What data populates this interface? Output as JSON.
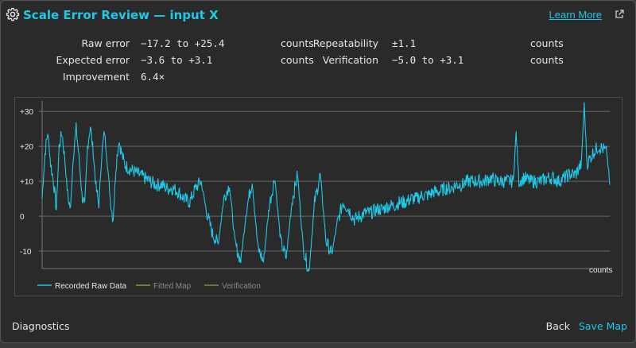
{
  "dialog": {
    "title": "Scale Error Review — input X",
    "learn_more": "Learn More",
    "icons": {
      "settings": "gear-icon",
      "external": "external-link-icon"
    }
  },
  "stats": {
    "raw_error": {
      "label": "Raw error",
      "value": "−17.2 to +25.4",
      "unit": "counts"
    },
    "expected_error": {
      "label": "Expected error",
      "value": "−3.6 to +3.1",
      "unit": "counts"
    },
    "improvement": {
      "label": "Improvement",
      "value": "6.4×"
    },
    "repeatability": {
      "label": "Repeatability",
      "value": "±1.1",
      "unit": "counts"
    },
    "verification": {
      "label": "Verification",
      "value": "−5.0 to +3.1",
      "unit": "counts"
    }
  },
  "chart_data": {
    "type": "line",
    "y_ticks": [
      "+30",
      "+20",
      "+10",
      "0",
      "-10"
    ],
    "ylim": [
      -15,
      33
    ],
    "unit_label": "counts",
    "grid": true,
    "legend_position": "bottom-left",
    "series": [
      {
        "name": "Recorded Raw Data",
        "color": "#1ec8e6",
        "points": [
          [
            0,
            5
          ],
          [
            0.5,
            18
          ],
          [
            1,
            24
          ],
          [
            1.5,
            15
          ],
          [
            2,
            10
          ],
          [
            2.5,
            2
          ],
          [
            3,
            20
          ],
          [
            3.5,
            24
          ],
          [
            4,
            16
          ],
          [
            4.5,
            6
          ],
          [
            5,
            2
          ],
          [
            5.5,
            18
          ],
          [
            6,
            25
          ],
          [
            6.5,
            17
          ],
          [
            7,
            6
          ],
          [
            7.5,
            3
          ],
          [
            8,
            20
          ],
          [
            8.5,
            26
          ],
          [
            9,
            18
          ],
          [
            9.5,
            8
          ],
          [
            10,
            3
          ],
          [
            10.5,
            18
          ],
          [
            11,
            24
          ],
          [
            11.5,
            15
          ],
          [
            12,
            5
          ],
          [
            12.5,
            -1
          ],
          [
            13,
            14
          ],
          [
            13.5,
            22
          ],
          [
            14,
            18
          ],
          [
            14.5,
            15
          ],
          [
            15,
            14
          ],
          [
            16,
            13
          ],
          [
            17,
            12
          ],
          [
            18,
            11
          ],
          [
            19,
            10
          ],
          [
            20,
            9
          ],
          [
            21,
            9
          ],
          [
            22,
            8
          ],
          [
            23,
            8
          ],
          [
            24,
            7
          ],
          [
            25,
            5
          ],
          [
            26,
            4
          ],
          [
            27,
            8
          ],
          [
            28,
            10
          ],
          [
            29,
            1
          ],
          [
            30,
            -5
          ],
          [
            31,
            -8
          ],
          [
            32,
            5
          ],
          [
            33,
            9
          ],
          [
            34,
            -8
          ],
          [
            35,
            -13
          ],
          [
            36,
            2
          ],
          [
            37,
            10
          ],
          [
            38,
            -9
          ],
          [
            39,
            -13
          ],
          [
            40,
            3
          ],
          [
            41,
            11
          ],
          [
            42,
            -7
          ],
          [
            43,
            -12
          ],
          [
            44,
            4
          ],
          [
            45,
            12
          ],
          [
            46,
            -9
          ],
          [
            47,
            -16
          ],
          [
            48,
            4
          ],
          [
            49,
            12
          ],
          [
            50,
            -7
          ],
          [
            51,
            -11
          ],
          [
            52,
            -2
          ],
          [
            53,
            4
          ],
          [
            54,
            2
          ],
          [
            55,
            -1
          ],
          [
            56,
            0
          ],
          [
            57,
            1
          ],
          [
            58,
            1
          ],
          [
            59,
            2
          ],
          [
            60,
            2
          ],
          [
            61,
            3
          ],
          [
            62,
            3
          ],
          [
            63,
            4
          ],
          [
            64,
            4
          ],
          [
            65,
            5
          ],
          [
            66,
            5
          ],
          [
            67,
            6
          ],
          [
            68,
            6
          ],
          [
            69,
            7
          ],
          [
            70,
            7
          ],
          [
            71,
            8
          ],
          [
            72,
            8
          ],
          [
            73,
            9
          ],
          [
            74,
            9
          ],
          [
            75,
            10
          ],
          [
            76,
            10
          ],
          [
            77,
            10
          ],
          [
            78,
            10
          ],
          [
            79,
            11
          ],
          [
            80,
            10
          ],
          [
            81,
            10
          ],
          [
            82,
            10
          ],
          [
            83,
            10
          ],
          [
            83.5,
            24
          ],
          [
            84,
            10
          ],
          [
            85,
            11
          ],
          [
            86,
            10
          ],
          [
            87,
            10
          ],
          [
            88,
            10
          ],
          [
            89,
            11
          ],
          [
            90,
            11
          ],
          [
            91,
            10
          ],
          [
            92,
            11
          ],
          [
            93,
            12
          ],
          [
            94,
            12
          ],
          [
            95,
            15
          ],
          [
            95.5,
            32
          ],
          [
            96,
            15
          ],
          [
            97,
            18
          ],
          [
            98,
            20
          ],
          [
            99,
            19
          ],
          [
            99.5,
            18
          ],
          [
            100,
            9
          ]
        ]
      },
      {
        "name": "Fitted Map",
        "color": "#8a9a3a",
        "points": []
      },
      {
        "name": "Verification",
        "color": "#8a8a3a",
        "points": []
      }
    ]
  },
  "footer": {
    "diagnostics": "Diagnostics",
    "back": "Back",
    "save": "Save Map"
  }
}
